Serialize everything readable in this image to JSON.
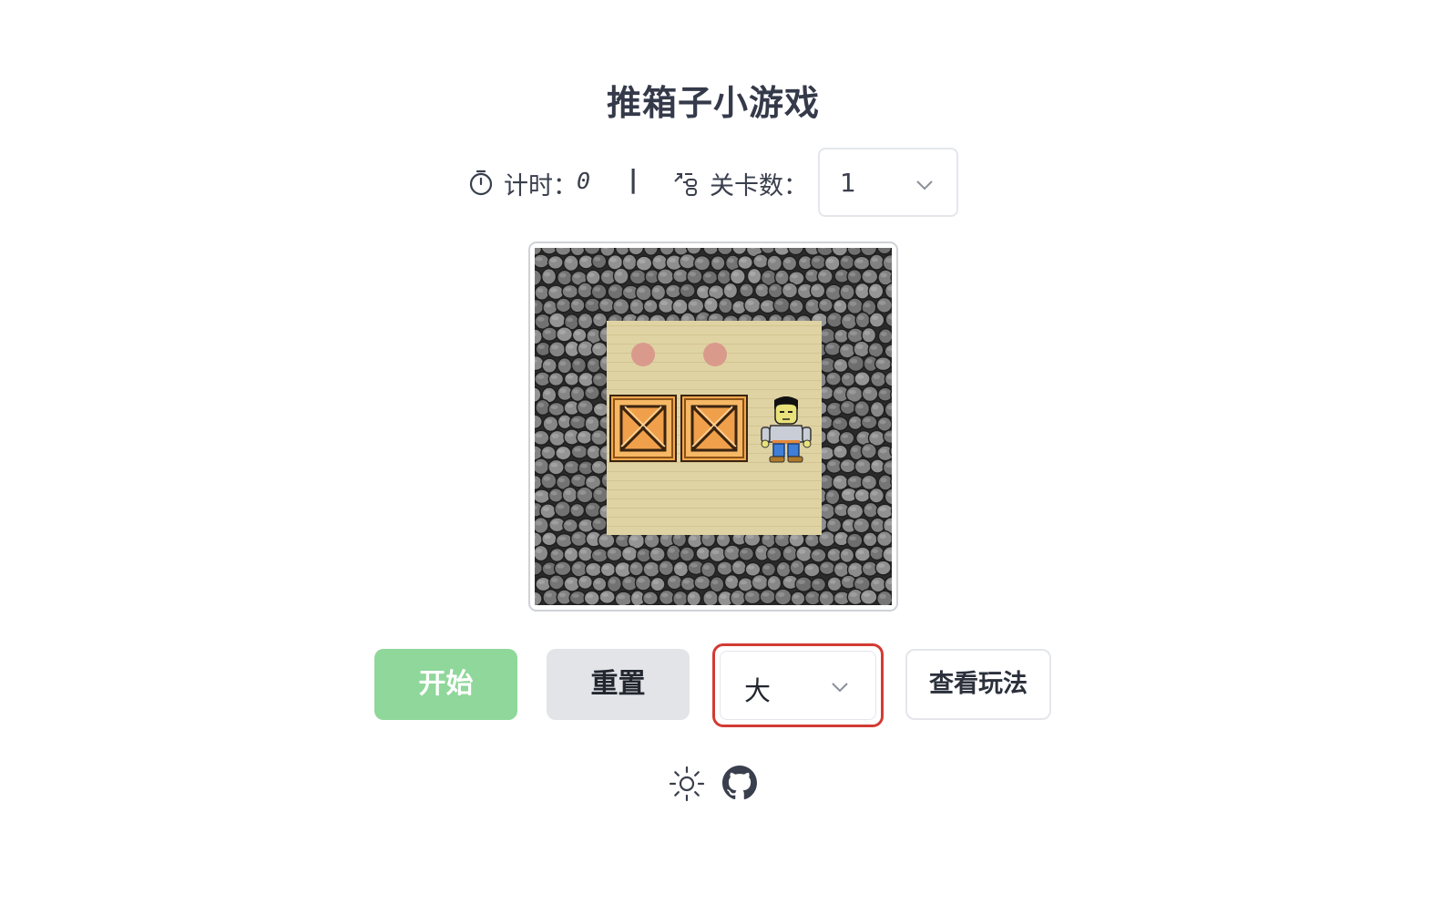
{
  "title": "推箱子小游戏",
  "status": {
    "timer_label": "计时：",
    "timer_value": "0",
    "divider": "|",
    "level_label": "关卡数：",
    "level_selected": "1"
  },
  "board": {
    "grid_cols": 5,
    "grid_rows": 5,
    "cells": [
      [
        "wall",
        "wall",
        "wall",
        "wall",
        "wall"
      ],
      [
        "wall",
        "target",
        "target",
        "floor",
        "wall"
      ],
      [
        "wall",
        "crate",
        "crate",
        "player",
        "wall"
      ],
      [
        "wall",
        "floor",
        "floor",
        "floor",
        "wall"
      ],
      [
        "wall",
        "wall",
        "wall",
        "wall",
        "wall"
      ]
    ]
  },
  "controls": {
    "start_label": "开始",
    "reset_label": "重置",
    "size_selected": "大",
    "help_label": "查看玩法"
  },
  "footer": {
    "theme_icon": "sun-icon",
    "repo_icon": "github-icon"
  },
  "colors": {
    "start_button": "#8fd79a",
    "reset_button": "#e3e4e8",
    "focus_ring": "#d23b33",
    "floor": "#dfd3a4",
    "target": "#d99a8c",
    "crate": "#f0a04b"
  }
}
